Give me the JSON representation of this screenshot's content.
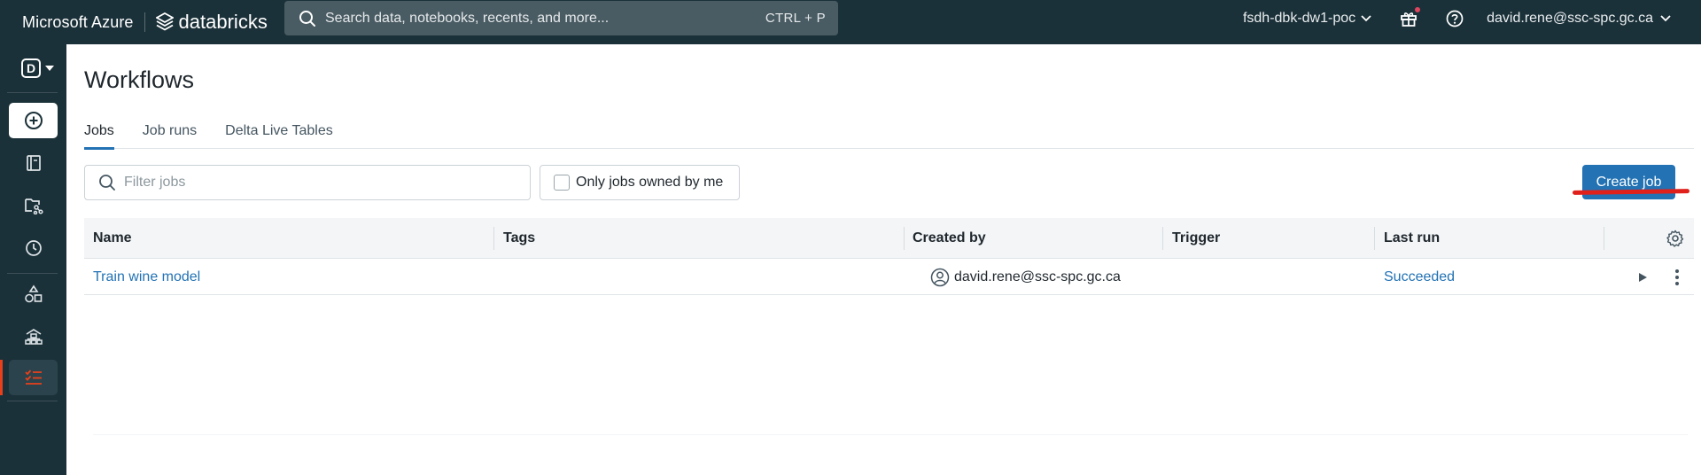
{
  "topbar": {
    "brand_azure": "Microsoft Azure",
    "brand_databricks": "databricks",
    "search_placeholder": "Search data, notebooks, recents, and more...",
    "search_shortcut": "CTRL + P",
    "workspace": "fsdh-dbk-dw1-poc",
    "user_email": "david.rene@ssc-spc.gc.ca",
    "notification_dot_color": "#e0455e"
  },
  "sidebar": {
    "workspace_letter": "D",
    "items": [
      {
        "name": "new",
        "icon": "plus-circle-icon"
      },
      {
        "name": "workspace",
        "icon": "notebook-icon"
      },
      {
        "name": "data",
        "icon": "folder-graph-icon"
      },
      {
        "name": "recents",
        "icon": "clock-icon"
      },
      {
        "name": "catalog",
        "icon": "shapes-icon"
      },
      {
        "name": "compute",
        "icon": "cluster-icon"
      },
      {
        "name": "workflows",
        "icon": "workflows-list-icon",
        "active": true
      }
    ],
    "active_color": "#e8401b"
  },
  "page": {
    "title": "Workflows",
    "tabs": [
      {
        "label": "Jobs",
        "active": true
      },
      {
        "label": "Job runs",
        "active": false
      },
      {
        "label": "Delta Live Tables",
        "active": false
      }
    ],
    "filter_placeholder": "Filter jobs",
    "owned_checkbox_label": "Only jobs owned by me",
    "owned_checked": false,
    "create_button": "Create job",
    "accent_color": "#2272b4"
  },
  "table": {
    "columns": [
      "Name",
      "Tags",
      "Created by",
      "Trigger",
      "Last run"
    ],
    "rows": [
      {
        "name": "Train wine model",
        "tags": "",
        "created_by": "david.rene@ssc-spc.gc.ca",
        "trigger": "",
        "last_run": "Succeeded"
      }
    ]
  }
}
